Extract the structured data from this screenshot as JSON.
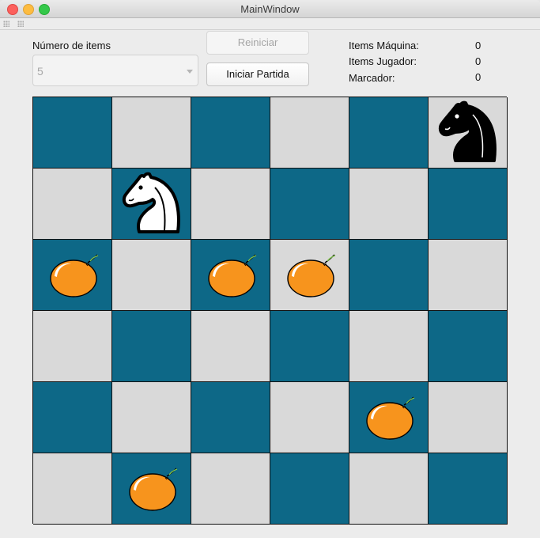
{
  "window": {
    "title": "MainWindow"
  },
  "controls": {
    "items_label": "Número de items",
    "items_value": "5",
    "restart_label": "Reiniciar",
    "start_label": "Iniciar Partida"
  },
  "stats": [
    {
      "label": "Items Máquina:",
      "value": "0"
    },
    {
      "label": "Items Jugador:",
      "value": "0"
    },
    {
      "label": "Marcador:",
      "value": "0"
    }
  ],
  "colors": {
    "dark_square": "#0d6887",
    "light_square": "#d9d9d9",
    "item": "#f7941d"
  },
  "board": {
    "rows": 6,
    "cols": 6,
    "cells": [
      [
        "dark",
        "light",
        "dark",
        "light",
        "dark",
        "light"
      ],
      [
        "light",
        "dark",
        "light",
        "dark",
        "light",
        "dark"
      ],
      [
        "dark",
        "light",
        "dark",
        "light",
        "dark",
        "light"
      ],
      [
        "light",
        "dark",
        "light",
        "dark",
        "light",
        "dark"
      ],
      [
        "dark",
        "light",
        "dark",
        "light",
        "dark",
        "light"
      ],
      [
        "light",
        "dark",
        "light",
        "dark",
        "light",
        "dark"
      ]
    ],
    "pieces": [
      {
        "row": 0,
        "col": 5,
        "type": "knight",
        "color": "black"
      },
      {
        "row": 1,
        "col": 1,
        "type": "knight",
        "color": "white"
      },
      {
        "row": 2,
        "col": 0,
        "type": "orange"
      },
      {
        "row": 2,
        "col": 2,
        "type": "orange"
      },
      {
        "row": 2,
        "col": 3,
        "type": "orange"
      },
      {
        "row": 4,
        "col": 4,
        "type": "orange"
      },
      {
        "row": 5,
        "col": 1,
        "type": "orange"
      }
    ]
  }
}
